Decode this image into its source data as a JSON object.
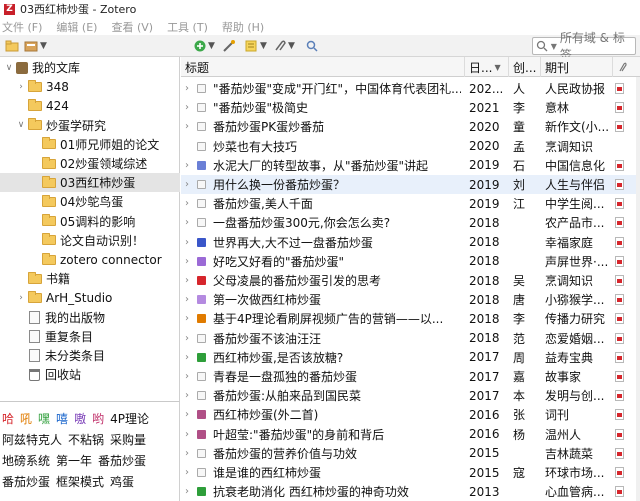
{
  "window": {
    "title": "03西红柿炒蛋 - Zotero",
    "app_icon": "Z"
  },
  "menu": [
    "文件 (F)",
    "编辑 (E)",
    "查看 (V)",
    "工具 (T)",
    "帮助 (H)"
  ],
  "search": {
    "placeholder": "所有域 & 标签"
  },
  "tree": [
    {
      "label": "我的文库",
      "icon": "library-icon",
      "twisty": "∨",
      "level": 0
    },
    {
      "label": "348",
      "icon": "folder-icon",
      "twisty": "›",
      "level": 1
    },
    {
      "label": "424",
      "icon": "folder-icon",
      "twisty": "",
      "level": 1
    },
    {
      "label": "炒蛋学研究",
      "icon": "folder-icon",
      "twisty": "∨",
      "level": 1
    },
    {
      "label": "01师兄师姐的论文",
      "icon": "folder-icon",
      "twisty": "",
      "level": 2
    },
    {
      "label": "02炒蛋领域综述",
      "icon": "folder-icon",
      "twisty": "",
      "level": 2
    },
    {
      "label": "03西红柿炒蛋",
      "icon": "folder-icon",
      "twisty": "",
      "level": 2,
      "selected": true
    },
    {
      "label": "04炒鸵鸟蛋",
      "icon": "folder-icon",
      "twisty": "",
      "level": 2
    },
    {
      "label": "05调料的影响",
      "icon": "folder-icon",
      "twisty": "",
      "level": 2
    },
    {
      "label": "论文自动识别！",
      "icon": "folder-icon",
      "twisty": "",
      "level": 2
    },
    {
      "label": "zotero connector",
      "icon": "folder-icon",
      "twisty": "",
      "level": 2
    },
    {
      "label": "书籍",
      "icon": "folder-icon",
      "twisty": "",
      "level": 1
    },
    {
      "label": "ArH_Studio",
      "icon": "folder-icon",
      "twisty": "›",
      "level": 1
    },
    {
      "label": "我的出版物",
      "icon": "publications-icon",
      "twisty": "",
      "level": 1
    },
    {
      "label": "重复条目",
      "icon": "duplicates-icon",
      "twisty": "",
      "level": 1
    },
    {
      "label": "未分类条目",
      "icon": "unfiled-icon",
      "twisty": "",
      "level": 1
    },
    {
      "label": "回收站",
      "icon": "trash-icon",
      "twisty": "",
      "level": 1
    }
  ],
  "tags": [
    [
      {
        "t": "哈",
        "c": "#d6262c"
      },
      {
        "t": "吼",
        "c": "#e07b00"
      },
      {
        "t": "嘿",
        "c": "#2e9e3a"
      },
      {
        "t": "嘻",
        "c": "#1a66cc"
      },
      {
        "t": "嗷",
        "c": "#7b3fb8"
      },
      {
        "t": "哟",
        "c": "#c0306a"
      },
      {
        "t": "4P理论",
        "c": "#111111"
      }
    ],
    [
      {
        "t": "阿兹特克人",
        "c": "#111111"
      },
      {
        "t": "不粘锅",
        "c": "#111111"
      },
      {
        "t": "采购量",
        "c": "#111111"
      }
    ],
    [
      {
        "t": "地磅系统",
        "c": "#111111"
      },
      {
        "t": "第一年",
        "c": "#111111"
      },
      {
        "t": "番茄炒蛋",
        "c": "#111111"
      }
    ],
    [
      {
        "t": "番茄炒蛋",
        "c": "#111111"
      },
      {
        "t": "框架模式",
        "c": "#111111"
      },
      {
        "t": "鸡蛋",
        "c": "#111111"
      }
    ]
  ],
  "columns": {
    "title": "标题",
    "date": "日...",
    "creator": "创...",
    "publication": "期刊"
  },
  "rows": [
    {
      "title": "\"番茄炒蛋\"变成\"开门红\"，中国体育代表团礼...",
      "date": "202...",
      "creator": "人",
      "pub": "人民政协报",
      "color": "",
      "chev": "›",
      "att": true
    },
    {
      "title": "\"番茄炒蛋\"极简史",
      "date": "2021",
      "creator": "李",
      "pub": "意林",
      "color": "",
      "chev": "›",
      "att": true
    },
    {
      "title": "番茄炒蛋PK蛋炒番茄",
      "date": "2020",
      "creator": "童",
      "pub": "新作文(小...",
      "color": "",
      "chev": "›",
      "att": true
    },
    {
      "title": "炒菜也有大技巧",
      "date": "2020",
      "creator": "孟",
      "pub": "烹调知识",
      "color": "",
      "chev": "",
      "att": false
    },
    {
      "title": "水泥大厂的转型故事，从\"番茄炒蛋\"讲起",
      "date": "2019",
      "creator": "石",
      "pub": "中国信息化",
      "color": "#6a7fd6",
      "chev": "›",
      "att": true
    },
    {
      "title": "用什么换一份番茄炒蛋？",
      "date": "2019",
      "creator": "刘",
      "pub": "人生与伴侣",
      "color": "",
      "chev": "›",
      "att": true,
      "sel": true
    },
    {
      "title": "番茄炒蛋,美人千面",
      "date": "2019",
      "creator": "江",
      "pub": "中学生阅...",
      "color": "",
      "chev": "›",
      "att": true
    },
    {
      "title": "一盘番茄炒蛋300元,你会怎么卖?",
      "date": "2018",
      "creator": "",
      "pub": "农产品市...",
      "color": "",
      "chev": "›",
      "att": true
    },
    {
      "title": "世界再大,大不过一盘番茄炒蛋",
      "date": "2018",
      "creator": "",
      "pub": "幸福家庭",
      "color": "#3a56c9",
      "chev": "›",
      "att": true
    },
    {
      "title": "好吃又好看的\"番茄炒蛋\"",
      "date": "2018",
      "creator": "",
      "pub": "声屏世界·...",
      "color": "#9b6ad6",
      "chev": "›",
      "att": true
    },
    {
      "title": "父母凌晨的番茄炒蛋引发的思考",
      "date": "2018",
      "creator": "吴",
      "pub": "烹调知识",
      "color": "#d6262c",
      "chev": "›",
      "att": true
    },
    {
      "title": "第一次做西红柿炒蛋",
      "date": "2018",
      "creator": "唐",
      "pub": "小猕猴学...",
      "color": "#b48ae0",
      "chev": "›",
      "att": true
    },
    {
      "title": "基于4P理论看刷屏视频广告的营销——以...",
      "date": "2018",
      "creator": "李",
      "pub": "传播力研究",
      "color": "#e07b00",
      "chev": "›",
      "att": true
    },
    {
      "title": "番茄炒蛋不该油汪汪",
      "date": "2018",
      "creator": "范",
      "pub": "恋爱婚姻...",
      "color": "",
      "chev": "›",
      "att": true
    },
    {
      "title": "西红柿炒蛋,是否该放糖?",
      "date": "2017",
      "creator": "周",
      "pub": "益寿宝典",
      "color": "#2e9e3a",
      "chev": "›",
      "att": true
    },
    {
      "title": "青春是一盘孤独的番茄炒蛋",
      "date": "2017",
      "creator": "嘉",
      "pub": "故事家",
      "color": "",
      "chev": "›",
      "att": true
    },
    {
      "title": "番茄炒蛋:从舶来品到国民菜",
      "date": "2017",
      "creator": "本",
      "pub": "发明与创...",
      "color": "",
      "chev": "›",
      "att": true
    },
    {
      "title": "西红柿炒蛋(外二首)",
      "date": "2016",
      "creator": "张",
      "pub": "词刊",
      "color": "#b04f86",
      "chev": "›",
      "att": true
    },
    {
      "title": "叶超莹:\"番茄炒蛋\"的身前和背后",
      "date": "2016",
      "creator": "杨",
      "pub": "温州人",
      "color": "#b04f86",
      "chev": "›",
      "att": true
    },
    {
      "title": "番茄炒蛋的营养价值与功效",
      "date": "2015",
      "creator": "",
      "pub": "吉林蔬菜",
      "color": "",
      "chev": "›",
      "att": true
    },
    {
      "title": "谁是谁的西红柿炒蛋",
      "date": "2015",
      "creator": "寇",
      "pub": "环球市场...",
      "color": "",
      "chev": "›",
      "att": true
    },
    {
      "title": "抗衰老助消化 西红柿炒蛋的神奇功效",
      "date": "2013",
      "creator": "",
      "pub": "心血管病...",
      "color": "#2e9e3a",
      "chev": "›",
      "att": true
    }
  ]
}
